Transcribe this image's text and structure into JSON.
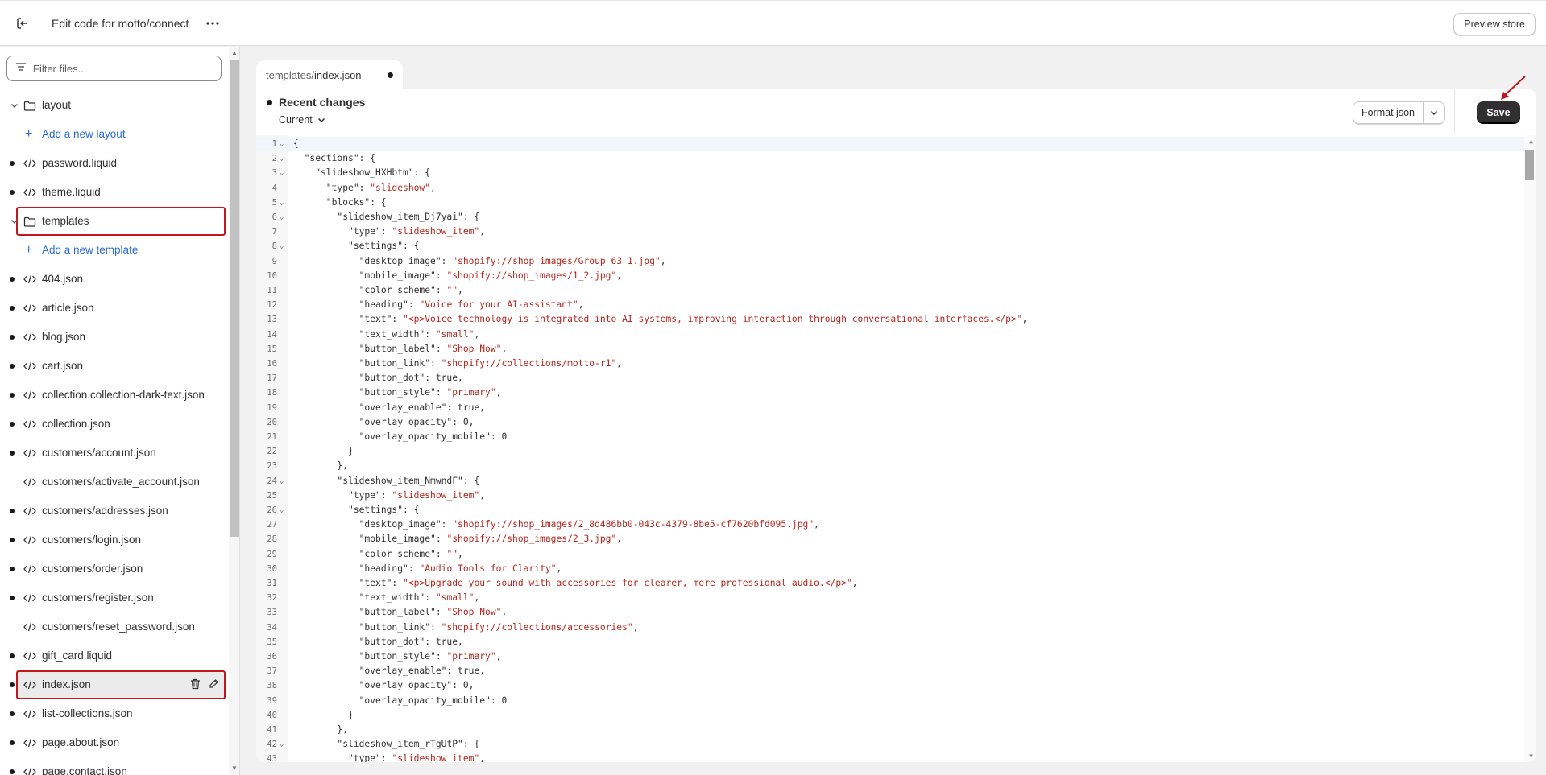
{
  "header": {
    "title": "Edit code for motto/connect",
    "preview_label": "Preview store"
  },
  "sidebar": {
    "filter_placeholder": "Filter files...",
    "items": [
      {
        "type": "folder",
        "label": "layout"
      },
      {
        "type": "add",
        "label": "Add a new layout"
      },
      {
        "type": "file",
        "label": "password.liquid",
        "dot": true
      },
      {
        "type": "file",
        "label": "theme.liquid",
        "dot": true
      },
      {
        "type": "folder",
        "label": "templates",
        "highlight": true
      },
      {
        "type": "add",
        "label": "Add a new template"
      },
      {
        "type": "file",
        "label": "404.json",
        "dot": true
      },
      {
        "type": "file",
        "label": "article.json",
        "dot": true
      },
      {
        "type": "file",
        "label": "blog.json",
        "dot": true
      },
      {
        "type": "file",
        "label": "cart.json",
        "dot": true
      },
      {
        "type": "file",
        "label": "collection.collection-dark-text.json",
        "dot": true
      },
      {
        "type": "file",
        "label": "collection.json",
        "dot": true
      },
      {
        "type": "file",
        "label": "customers/account.json",
        "dot": true
      },
      {
        "type": "file",
        "label": "customers/activate_account.json",
        "dot": false
      },
      {
        "type": "file",
        "label": "customers/addresses.json",
        "dot": true
      },
      {
        "type": "file",
        "label": "customers/login.json",
        "dot": true
      },
      {
        "type": "file",
        "label": "customers/order.json",
        "dot": true
      },
      {
        "type": "file",
        "label": "customers/register.json",
        "dot": true
      },
      {
        "type": "file",
        "label": "customers/reset_password.json",
        "dot": false
      },
      {
        "type": "file",
        "label": "gift_card.liquid",
        "dot": true
      },
      {
        "type": "file",
        "label": "index.json",
        "dot": true,
        "highlight": true,
        "selected": true
      },
      {
        "type": "file",
        "label": "list-collections.json",
        "dot": true
      },
      {
        "type": "file",
        "label": "page.about.json",
        "dot": true
      },
      {
        "type": "file",
        "label": "page.contact.json",
        "dot": true
      }
    ]
  },
  "editor": {
    "tab_prefix": "templates/",
    "tab_file": "index.json",
    "recent_changes": "Recent changes",
    "version": "Current",
    "format_label": "Format json",
    "save_label": "Save",
    "lines": [
      {
        "n": "1",
        "fold": true,
        "segs": [
          [
            "p",
            "{"
          ]
        ]
      },
      {
        "n": "2",
        "fold": true,
        "segs": [
          [
            "p",
            "  \"sections\": {"
          ]
        ]
      },
      {
        "n": "3",
        "fold": true,
        "segs": [
          [
            "p",
            "    \"slideshow_HXHbtm\": {"
          ]
        ]
      },
      {
        "n": "4",
        "fold": false,
        "segs": [
          [
            "p",
            "      \"type\": "
          ],
          [
            "s",
            "\"slideshow\""
          ],
          [
            "p",
            ","
          ]
        ]
      },
      {
        "n": "5",
        "fold": true,
        "segs": [
          [
            "p",
            "      \"blocks\": {"
          ]
        ]
      },
      {
        "n": "6",
        "fold": true,
        "segs": [
          [
            "p",
            "        \"slideshow_item_Dj7yai\": {"
          ]
        ]
      },
      {
        "n": "7",
        "fold": false,
        "segs": [
          [
            "p",
            "          \"type\": "
          ],
          [
            "s",
            "\"slideshow_item\""
          ],
          [
            "p",
            ","
          ]
        ]
      },
      {
        "n": "8",
        "fold": true,
        "segs": [
          [
            "p",
            "          \"settings\": {"
          ]
        ]
      },
      {
        "n": "9",
        "fold": false,
        "segs": [
          [
            "p",
            "            \"desktop_image\": "
          ],
          [
            "s",
            "\"shopify://shop_images/Group_63_1.jpg\""
          ],
          [
            "p",
            ","
          ]
        ]
      },
      {
        "n": "10",
        "fold": false,
        "segs": [
          [
            "p",
            "            \"mobile_image\": "
          ],
          [
            "s",
            "\"shopify://shop_images/1_2.jpg\""
          ],
          [
            "p",
            ","
          ]
        ]
      },
      {
        "n": "11",
        "fold": false,
        "segs": [
          [
            "p",
            "            \"color_scheme\": "
          ],
          [
            "s",
            "\"\""
          ],
          [
            "p",
            ","
          ]
        ]
      },
      {
        "n": "12",
        "fold": false,
        "segs": [
          [
            "p",
            "            \"heading\": "
          ],
          [
            "s",
            "\"Voice for your AI-assistant\""
          ],
          [
            "p",
            ","
          ]
        ]
      },
      {
        "n": "13",
        "fold": false,
        "segs": [
          [
            "p",
            "            \"text\": "
          ],
          [
            "s",
            "\"<p>Voice technology is integrated into AI systems, improving interaction through conversational interfaces.</p>\""
          ],
          [
            "p",
            ","
          ]
        ]
      },
      {
        "n": "14",
        "fold": false,
        "segs": [
          [
            "p",
            "            \"text_width\": "
          ],
          [
            "s",
            "\"small\""
          ],
          [
            "p",
            ","
          ]
        ]
      },
      {
        "n": "15",
        "fold": false,
        "segs": [
          [
            "p",
            "            \"button_label\": "
          ],
          [
            "s",
            "\"Shop Now\""
          ],
          [
            "p",
            ","
          ]
        ]
      },
      {
        "n": "16",
        "fold": false,
        "segs": [
          [
            "p",
            "            \"button_link\": "
          ],
          [
            "s",
            "\"shopify://collections/motto-r1\""
          ],
          [
            "p",
            ","
          ]
        ]
      },
      {
        "n": "17",
        "fold": false,
        "segs": [
          [
            "p",
            "            \"button_dot\": true,"
          ]
        ]
      },
      {
        "n": "18",
        "fold": false,
        "segs": [
          [
            "p",
            "            \"button_style\": "
          ],
          [
            "s",
            "\"primary\""
          ],
          [
            "p",
            ","
          ]
        ]
      },
      {
        "n": "19",
        "fold": false,
        "segs": [
          [
            "p",
            "            \"overlay_enable\": true,"
          ]
        ]
      },
      {
        "n": "20",
        "fold": false,
        "segs": [
          [
            "p",
            "            \"overlay_opacity\": 0,"
          ]
        ]
      },
      {
        "n": "21",
        "fold": false,
        "segs": [
          [
            "p",
            "            \"overlay_opacity_mobile\": 0"
          ]
        ]
      },
      {
        "n": "22",
        "fold": false,
        "segs": [
          [
            "p",
            "          }"
          ]
        ]
      },
      {
        "n": "23",
        "fold": false,
        "segs": [
          [
            "p",
            "        },"
          ]
        ]
      },
      {
        "n": "24",
        "fold": true,
        "segs": [
          [
            "p",
            "        \"slideshow_item_NmwndF\": {"
          ]
        ]
      },
      {
        "n": "25",
        "fold": false,
        "segs": [
          [
            "p",
            "          \"type\": "
          ],
          [
            "s",
            "\"slideshow_item\""
          ],
          [
            "p",
            ","
          ]
        ]
      },
      {
        "n": "26",
        "fold": true,
        "segs": [
          [
            "p",
            "          \"settings\": {"
          ]
        ]
      },
      {
        "n": "27",
        "fold": false,
        "segs": [
          [
            "p",
            "            \"desktop_image\": "
          ],
          [
            "s",
            "\"shopify://shop_images/2_8d486bb0-043c-4379-8be5-cf7620bfd095.jpg\""
          ],
          [
            "p",
            ","
          ]
        ]
      },
      {
        "n": "28",
        "fold": false,
        "segs": [
          [
            "p",
            "            \"mobile_image\": "
          ],
          [
            "s",
            "\"shopify://shop_images/2_3.jpg\""
          ],
          [
            "p",
            ","
          ]
        ]
      },
      {
        "n": "29",
        "fold": false,
        "segs": [
          [
            "p",
            "            \"color_scheme\": "
          ],
          [
            "s",
            "\"\""
          ],
          [
            "p",
            ","
          ]
        ]
      },
      {
        "n": "30",
        "fold": false,
        "segs": [
          [
            "p",
            "            \"heading\": "
          ],
          [
            "s",
            "\"Audio Tools for Clarity\""
          ],
          [
            "p",
            ","
          ]
        ]
      },
      {
        "n": "31",
        "fold": false,
        "segs": [
          [
            "p",
            "            \"text\": "
          ],
          [
            "s",
            "\"<p>Upgrade your sound with accessories for clearer, more professional audio.</p>\""
          ],
          [
            "p",
            ","
          ]
        ]
      },
      {
        "n": "32",
        "fold": false,
        "segs": [
          [
            "p",
            "            \"text_width\": "
          ],
          [
            "s",
            "\"small\""
          ],
          [
            "p",
            ","
          ]
        ]
      },
      {
        "n": "33",
        "fold": false,
        "segs": [
          [
            "p",
            "            \"button_label\": "
          ],
          [
            "s",
            "\"Shop Now\""
          ],
          [
            "p",
            ","
          ]
        ]
      },
      {
        "n": "34",
        "fold": false,
        "segs": [
          [
            "p",
            "            \"button_link\": "
          ],
          [
            "s",
            "\"shopify://collections/accessories\""
          ],
          [
            "p",
            ","
          ]
        ]
      },
      {
        "n": "35",
        "fold": false,
        "segs": [
          [
            "p",
            "            \"button_dot\": true,"
          ]
        ]
      },
      {
        "n": "36",
        "fold": false,
        "segs": [
          [
            "p",
            "            \"button_style\": "
          ],
          [
            "s",
            "\"primary\""
          ],
          [
            "p",
            ","
          ]
        ]
      },
      {
        "n": "37",
        "fold": false,
        "segs": [
          [
            "p",
            "            \"overlay_enable\": true,"
          ]
        ]
      },
      {
        "n": "38",
        "fold": false,
        "segs": [
          [
            "p",
            "            \"overlay_opacity\": 0,"
          ]
        ]
      },
      {
        "n": "39",
        "fold": false,
        "segs": [
          [
            "p",
            "            \"overlay_opacity_mobile\": 0"
          ]
        ]
      },
      {
        "n": "40",
        "fold": false,
        "segs": [
          [
            "p",
            "          }"
          ]
        ]
      },
      {
        "n": "41",
        "fold": false,
        "segs": [
          [
            "p",
            "        },"
          ]
        ]
      },
      {
        "n": "42",
        "fold": true,
        "segs": [
          [
            "p",
            "        \"slideshow_item_rTgUtP\": {"
          ]
        ]
      },
      {
        "n": "43",
        "fold": false,
        "segs": [
          [
            "p",
            "          \"type\": "
          ],
          [
            "s",
            "\"slideshow_item\""
          ],
          [
            "p",
            ","
          ]
        ]
      }
    ]
  },
  "colors": {
    "accent_link": "#2c6ecb",
    "highlight_border": "#c4161c",
    "string": "#b3261e",
    "save_bg": "#303030"
  }
}
